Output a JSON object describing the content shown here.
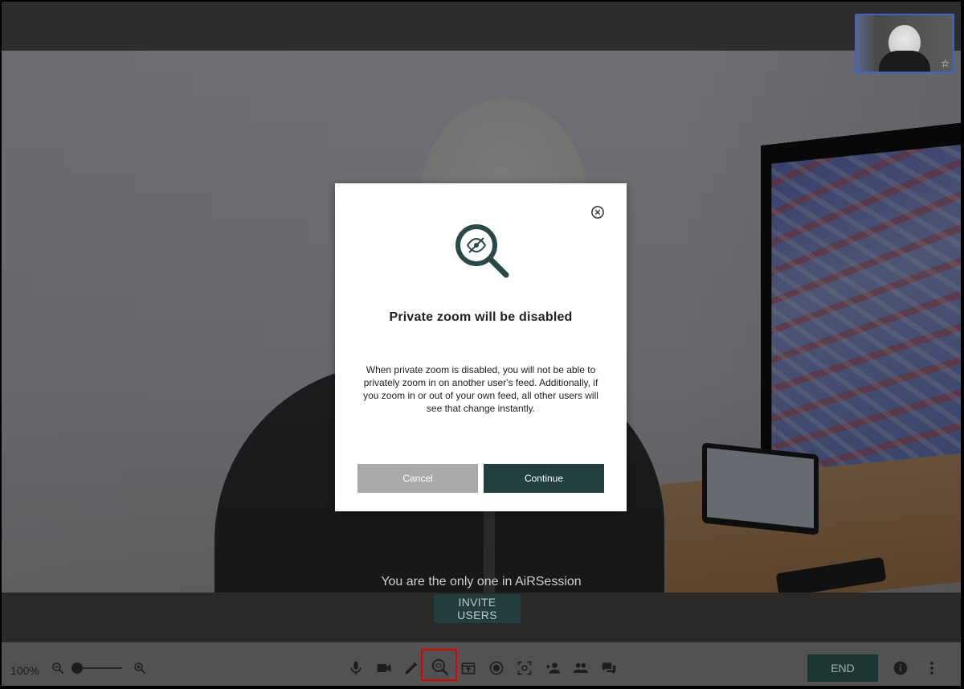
{
  "session": {
    "status_text": "You are the only one in AiRSession",
    "invite_label": "INVITE USERS"
  },
  "toolbar": {
    "zoom_level": "100%",
    "end_label": "END",
    "icons": [
      "zoom-out-icon",
      "zoom-in-icon",
      "microphone-icon",
      "camera-icon",
      "pencil-icon",
      "private-zoom-icon",
      "share-screen-icon",
      "record-icon",
      "screenshot-icon",
      "add-user-icon",
      "participants-icon",
      "chat-icon",
      "info-icon",
      "more-vert-icon"
    ]
  },
  "modal": {
    "title": "Private zoom will be disabled",
    "body": "When private zoom is disabled, you will not be able to privately zoom in on another user's feed. Additionally, if you zoom in or out of your own feed, all other users will see that change instantly.",
    "cancel_label": "Cancel",
    "continue_label": "Continue"
  },
  "pip": {
    "star": "☆"
  },
  "colors": {
    "accent": "#22403f",
    "highlight": "#e00000",
    "pip_border": "#3e64c8"
  }
}
